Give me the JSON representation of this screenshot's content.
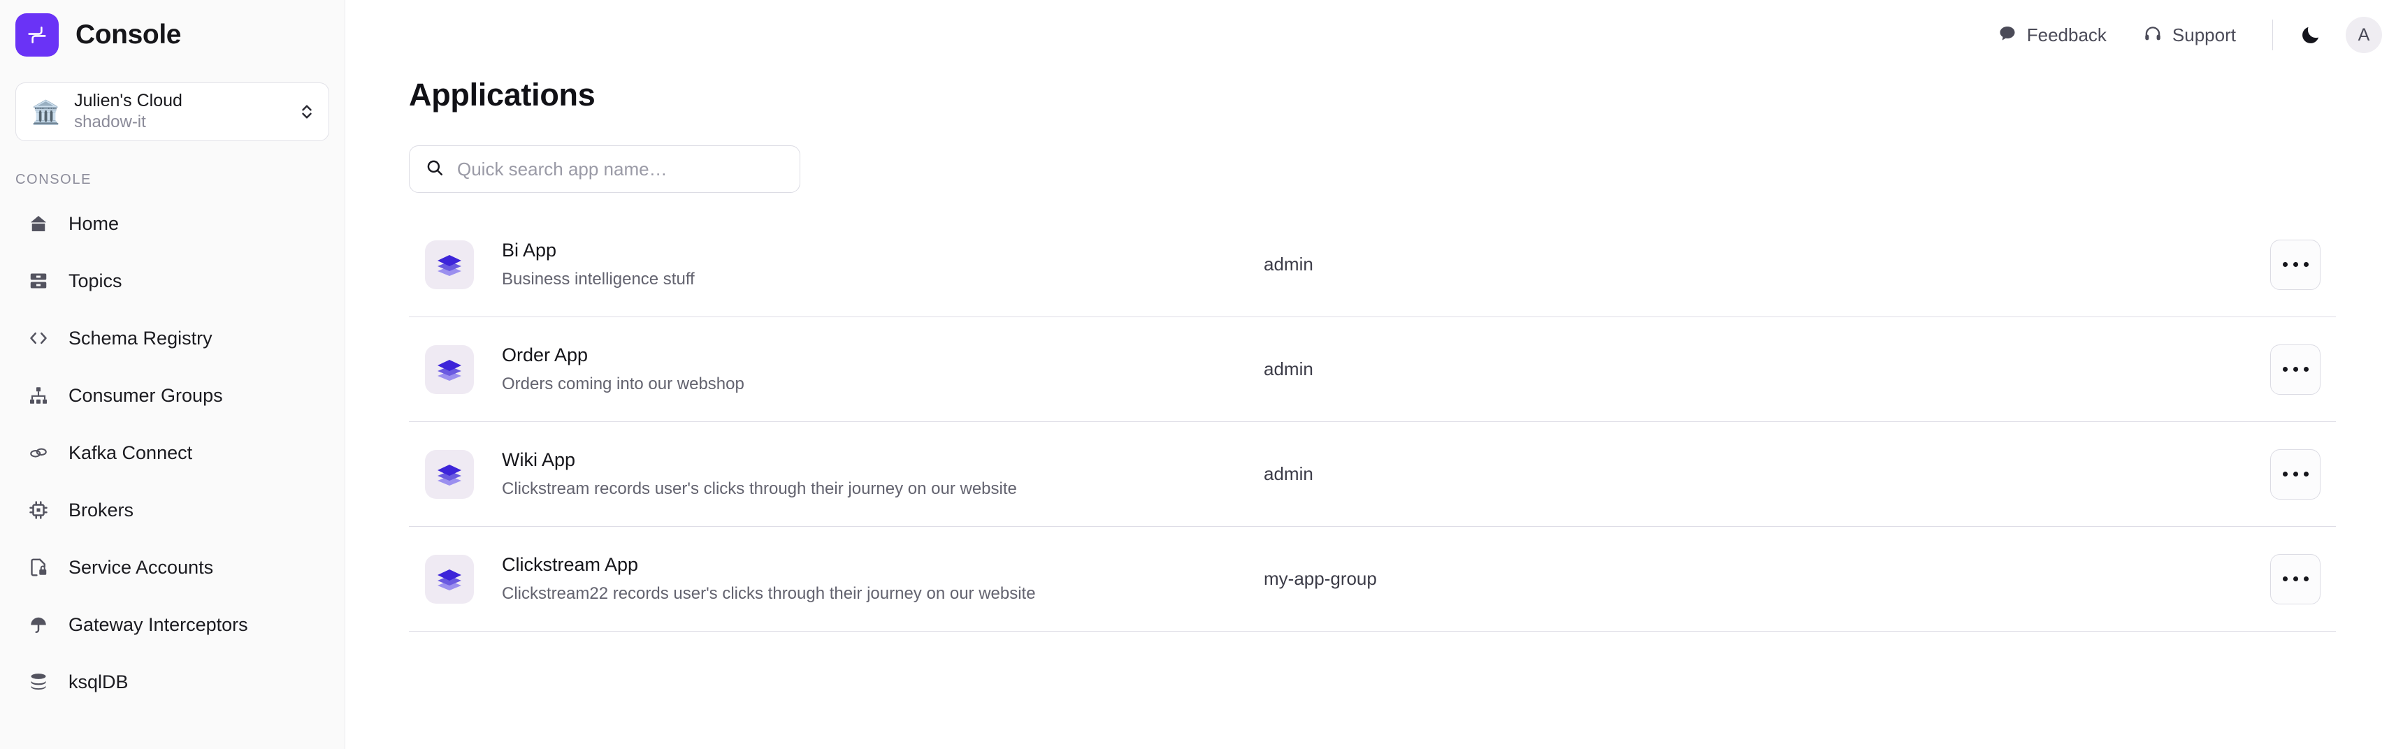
{
  "brand": {
    "title": "Console",
    "logo_icon": "junction-logo-icon",
    "logo_color": "#6A33F6"
  },
  "cloud_selector": {
    "icon": "classical-building-icon",
    "emoji": "🏛️",
    "name": "Julien's Cloud",
    "subtitle": "shadow-it",
    "chevron_icon": "chevron-up-down-icon"
  },
  "sidebar": {
    "section_label": "CONSOLE",
    "items": [
      {
        "label": "Home",
        "icon": "home-icon"
      },
      {
        "label": "Topics",
        "icon": "topics-icon"
      },
      {
        "label": "Schema Registry",
        "icon": "code-brackets-icon"
      },
      {
        "label": "Consumer Groups",
        "icon": "hierarchy-icon"
      },
      {
        "label": "Kafka Connect",
        "icon": "link-chain-icon"
      },
      {
        "label": "Brokers",
        "icon": "chip-icon"
      },
      {
        "label": "Service Accounts",
        "icon": "file-lock-icon"
      },
      {
        "label": "Gateway Interceptors",
        "icon": "umbrella-icon"
      },
      {
        "label": "ksqlDB",
        "icon": "database-icon"
      }
    ]
  },
  "topbar": {
    "feedback_label": "Feedback",
    "feedback_icon": "chat-bubble-icon",
    "support_label": "Support",
    "support_icon": "headphones-icon",
    "theme_icon": "moon-icon",
    "avatar_initial": "A"
  },
  "main": {
    "page_title": "Applications",
    "search": {
      "placeholder": "Quick search app name…",
      "value": "",
      "icon": "search-icon"
    },
    "rows": [
      {
        "icon": "stacked-layers-icon",
        "name": "Bi App",
        "description": "Business intelligence stuff",
        "group": "admin",
        "menu_icon": "ellipsis-icon"
      },
      {
        "icon": "stacked-layers-icon",
        "name": "Order App",
        "description": "Orders coming into our webshop",
        "group": "admin",
        "menu_icon": "ellipsis-icon"
      },
      {
        "icon": "stacked-layers-icon",
        "name": "Wiki App",
        "description": "Clickstream records user's clicks through their journey on our website",
        "group": "admin",
        "menu_icon": "ellipsis-icon"
      },
      {
        "icon": "stacked-layers-icon",
        "name": "Clickstream App",
        "description": "Clickstream22 records user's clicks through their journey on our website",
        "group": "my-app-group",
        "menu_icon": "ellipsis-icon"
      }
    ]
  },
  "colors": {
    "accent": "#6A33F6",
    "icon_layer_top": "#3D24D9",
    "icon_layer_mid": "#6A5AE0",
    "icon_layer_bottom": "#9B8FEF",
    "icon_bg": "#EFEAF3",
    "sidebar_bg": "#FAFAFA",
    "row_divider": "#DEDDE6"
  }
}
